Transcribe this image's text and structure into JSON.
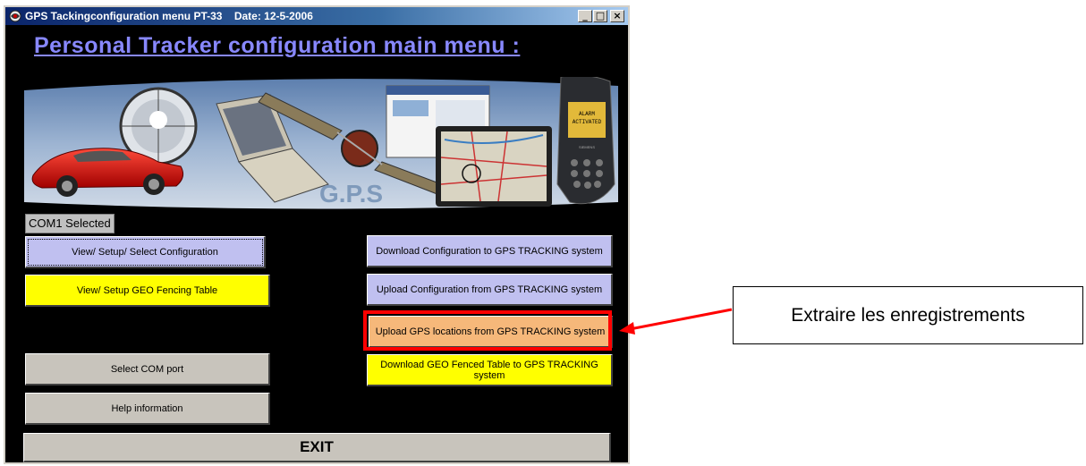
{
  "window": {
    "title": "GPS Tackingconfiguration menu PT-33    Date: 12-5-2006",
    "controls": {
      "minimize": "_",
      "maximize": "□",
      "close": "×"
    }
  },
  "main": {
    "heading": "Personal Tracker configuration main menu :",
    "banner_text": "G.P.S",
    "status": "COM1 Selected"
  },
  "phone": {
    "screen_line1": "ALARM",
    "screen_line2": "ACTIVATED",
    "brand": "SIEMENS"
  },
  "buttons": {
    "view_setup_config": "View/ Setup/ Select Configuration",
    "view_setup_geo": "View/ Setup GEO Fencing Table",
    "select_com": "Select COM port",
    "help": "Help information",
    "download_config": "Download Configuration to GPS TRACKING system",
    "upload_config": "Upload Configuration from GPS TRACKING system",
    "upload_locations": "Upload GPS locations from GPS TRACKING system",
    "download_geo": "Download GEO Fenced Table to GPS TRACKING system",
    "exit": "EXIT"
  },
  "annotation": {
    "callout": "Extraire les enregistrements",
    "arrow_color": "#ff0000"
  },
  "colors": {
    "background": "#000000",
    "heading": "#8888ff",
    "lavender": "#c0c0f0",
    "yellow": "#ffff00",
    "orange": "#f6b87a",
    "highlight": "#ff0000"
  }
}
